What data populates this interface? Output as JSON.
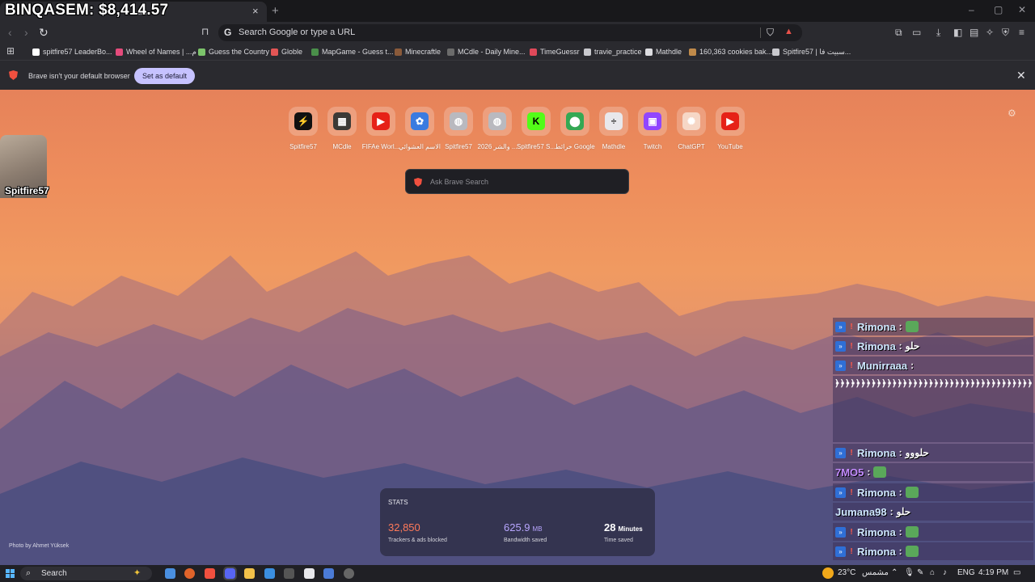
{
  "overlay": {
    "balance": "BINQASEM: $8,414.57",
    "streamer_name": "Spitfire57"
  },
  "tab": {
    "title": "ab",
    "close": "×",
    "new_tab": "+"
  },
  "window_controls": {
    "minimize": "–",
    "maximize": "▢",
    "close": "✕"
  },
  "address_bar": {
    "back": "‹",
    "forward": "›",
    "reload": "↻",
    "g_icon": "G",
    "placeholder": "Search Google or type a URL"
  },
  "bookmarks": [
    {
      "label": "spitfire57 LeaderBo...",
      "color": "#ffffff"
    },
    {
      "label": "Wheel of Names | ...م",
      "color": "#e54b7c"
    },
    {
      "label": "Guess the Country",
      "color": "#7cc46b"
    },
    {
      "label": "Globle",
      "color": "#e25555"
    },
    {
      "label": "MapGame - Guess t...",
      "color": "#4a8f4a"
    },
    {
      "label": "Minecraftle",
      "color": "#8a5a3a"
    },
    {
      "label": "MCdle - Daily Mine...",
      "color": "#6b6b6b"
    },
    {
      "label": "TimeGuessr",
      "color": "#e0495a"
    },
    {
      "label": "travie_practice",
      "color": "#c9c9ce"
    },
    {
      "label": "Mathdle",
      "color": "#dcdce0"
    },
    {
      "label": "160,363 cookies bak...",
      "color": "#c08a4a"
    },
    {
      "label": "Spitfire57 | سبيت فا...",
      "color": "#c9c9ce"
    }
  ],
  "infobar": {
    "message": "Brave isn't your default browser",
    "button": "Set as default",
    "close": "✕"
  },
  "top_sites": [
    {
      "label": "Spitfire57",
      "glyph": "⚡",
      "bg": "#111111"
    },
    {
      "label": "MCdle",
      "glyph": "▦",
      "bg": "#3c3a36"
    },
    {
      "label": "FIFAe Worl...",
      "glyph": "▶",
      "bg": "#e62117"
    },
    {
      "label": "الاسم العشوائي",
      "glyph": "✿",
      "bg": "#3b7be0"
    },
    {
      "label": "Spitfire57",
      "glyph": "◍",
      "bg": "#b9b9bf"
    },
    {
      "label": "2026 والشر ...",
      "glyph": "◍",
      "bg": "#b9b9bf"
    },
    {
      "label": "Spitfire57 S...",
      "glyph": "K",
      "bg": "#53fc18"
    },
    {
      "label": "خرائط Google",
      "glyph": "⬤",
      "bg": "#34a853"
    },
    {
      "label": "Mathdle",
      "glyph": "÷",
      "bg": "#e8e8ec"
    },
    {
      "label": "Twitch",
      "glyph": "▣",
      "bg": "#9146ff"
    },
    {
      "label": "ChatGPT",
      "glyph": "✺",
      "bg": "#f6d7c6"
    },
    {
      "label": "YouTube",
      "glyph": "▶",
      "bg": "#e62117"
    }
  ],
  "search": {
    "placeholder": "Ask Brave Search"
  },
  "photo_credit": "Photo by Ahmet Yüksek",
  "stats": {
    "title": "STATS",
    "trackers": {
      "value": "32,850",
      "unit": "",
      "label": "Trackers & ads blocked",
      "color": "#ff7a5a"
    },
    "bandwidth": {
      "value": "625.9",
      "unit": "MB",
      "label": "Bandwidth saved",
      "color": "#b8a6ff"
    },
    "time": {
      "value": "28",
      "unit": "Minutes",
      "label": "Time saved",
      "color": "#ffffff"
    }
  },
  "chat": [
    {
      "name": "Rimona",
      "msg": "",
      "emote": true,
      "badge": true
    },
    {
      "name": "Rimona",
      "msg": "حلو",
      "emote": false,
      "badge": true
    },
    {
      "name": "Munirraaa",
      "msg": "",
      "emote": false,
      "badge": true
    },
    {
      "name": "Rimona",
      "msg": "حلووو",
      "emote": false,
      "badge": true
    },
    {
      "name": "7MO5",
      "msg": "",
      "emote": true,
      "badge": false
    },
    {
      "name": "Rimona",
      "msg": "",
      "emote": true,
      "badge": true
    },
    {
      "name": "Jumana98",
      "msg": "حلو",
      "emote": false,
      "badge": false
    },
    {
      "name": "Rimona",
      "msg": "",
      "emote": true,
      "badge": true
    },
    {
      "name": "Rimona",
      "msg": "",
      "emote": true,
      "badge": true
    }
  ],
  "chat_spam": "﴿﴿﴿﴿﴿﴿﴿﴿﴿﴿﴿﴿﴿﴿﴿﴿﴿﴿﴿﴿﴿﴿﴿﴿﴿﴿﴿﴿﴿﴿﴿﴿﴿﴿﴿﴿﴿﴿",
  "taskbar": {
    "search_label": "Search",
    "temperature": "23°C",
    "weather": "مشمس",
    "language": "ENG",
    "time": "4:19 PM"
  }
}
